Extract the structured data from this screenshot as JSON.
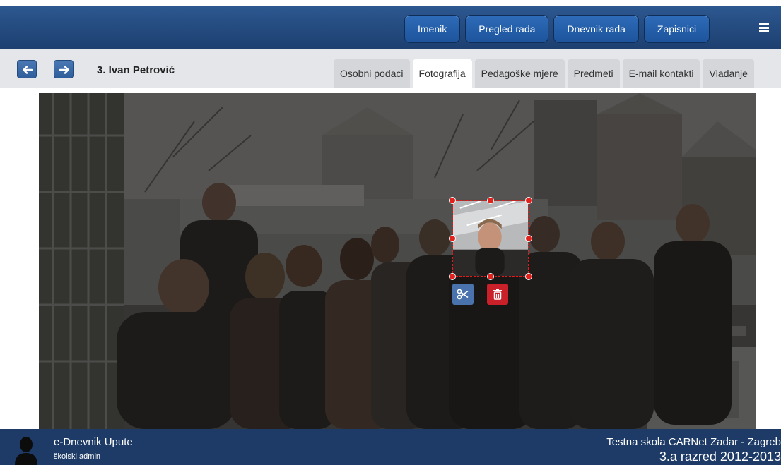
{
  "header": {
    "nav": [
      "Imenik",
      "Pregled rada",
      "Dnevnik rada",
      "Zapisnici"
    ],
    "menu_icon": "hamburger-icon"
  },
  "student": {
    "back_icon": "arrow-left-icon",
    "forward_icon": "arrow-right-icon",
    "name": "3. Ivan Petrović"
  },
  "tabs": [
    {
      "label": "Osobni podaci",
      "active": false
    },
    {
      "label": "Fotografija",
      "active": true
    },
    {
      "label": "Pedagoške mjere",
      "active": false
    },
    {
      "label": "Predmeti",
      "active": false
    },
    {
      "label": "E-mail kontakti",
      "active": false
    },
    {
      "label": "Vladanje",
      "active": false
    }
  ],
  "photo_tools": {
    "crop_icon": "scissors-icon",
    "delete_icon": "trash-icon"
  },
  "footer": {
    "app_name": "e-Dnevnik Upute",
    "role": "školski admin",
    "school": "Testna skola CARNet Zadar - Zagreb",
    "class_year": "3.a razred 2012-2013"
  },
  "colors": {
    "header_bg": "#1d3f70",
    "nav_button": "#2563ad",
    "footer_bg": "#1d3b66",
    "crop_border": "#e01b1b",
    "delete_button": "#c9202a",
    "crop_button": "#4a72ad"
  }
}
